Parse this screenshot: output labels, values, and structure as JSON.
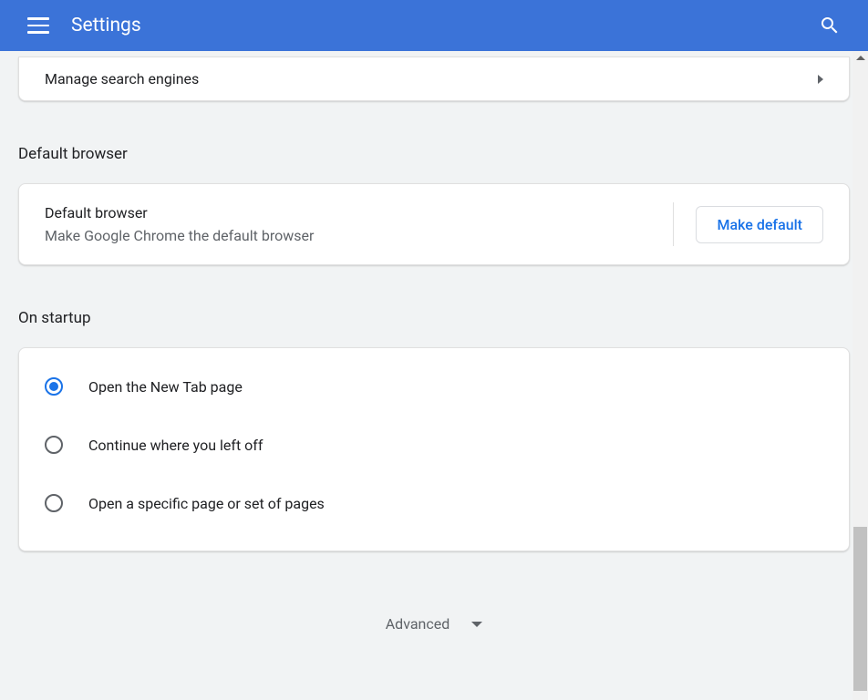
{
  "header": {
    "title": "Settings"
  },
  "search_engines": {
    "manage_label": "Manage search engines"
  },
  "default_browser": {
    "section_title": "Default browser",
    "line1": "Default browser",
    "line2": "Make Google Chrome the default browser",
    "button_label": "Make default"
  },
  "startup": {
    "section_title": "On startup",
    "options": [
      {
        "label": "Open the New Tab page",
        "selected": true
      },
      {
        "label": "Continue where you left off",
        "selected": false
      },
      {
        "label": "Open a specific page or set of pages",
        "selected": false
      }
    ]
  },
  "advanced": {
    "label": "Advanced"
  }
}
